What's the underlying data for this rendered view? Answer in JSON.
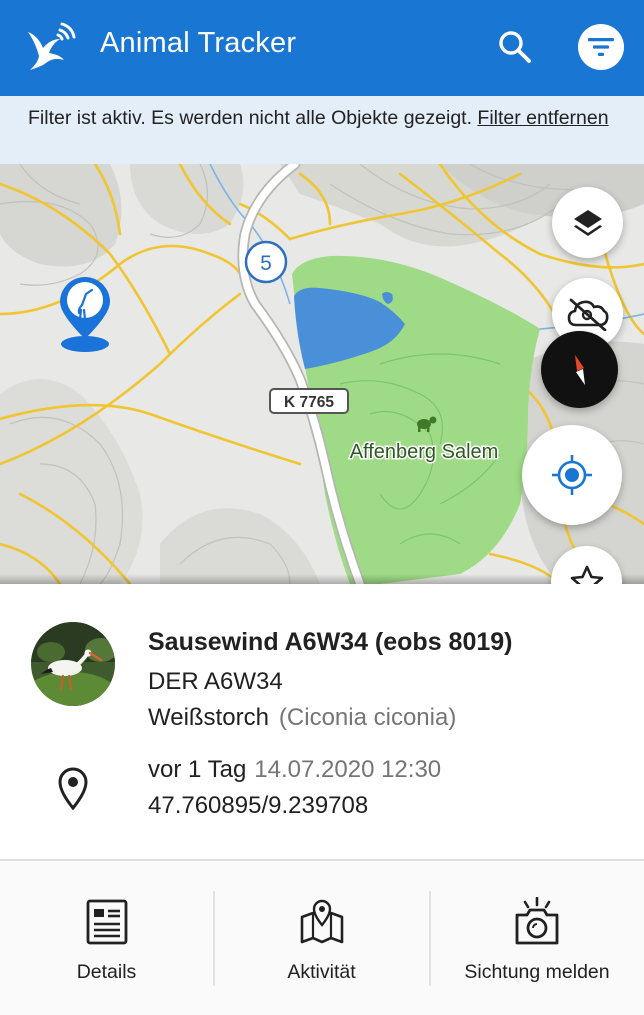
{
  "app": {
    "title": "Animal Tracker",
    "accent_color": "#1976d2"
  },
  "header": {
    "logo_icon": "bird-signal-logo-icon",
    "search_icon": "search-icon",
    "filter_icon": "filter-icon"
  },
  "filter_banner": {
    "text": "Filter ist aktiv. Es werden nicht alle Objekte gezeigt. ",
    "link": "Filter entfernen"
  },
  "map": {
    "road_label": "K 7765",
    "route_number": "5",
    "place_label": "Affenberg Salem",
    "buttons": [
      "layers-icon",
      "cloud-off-icon",
      "compass-icon",
      "my-location-icon",
      "star-icon"
    ]
  },
  "animal": {
    "name": "Sausewind A6W34 (eobs 8019)",
    "tag": "DER A6W34",
    "species": "Weißstorch",
    "species_latin": "(Ciconia ciconia)",
    "last_seen": "vor 1 Tag",
    "timestamp": "14.07.2020 12:30",
    "coordinates": "47.760895/9.239708"
  },
  "actions": [
    {
      "label": "Details",
      "icon": "details-document-icon"
    },
    {
      "label": "Aktivität",
      "icon": "map-route-icon"
    },
    {
      "label": "Sichtung melden",
      "icon": "camera-icon"
    }
  ]
}
